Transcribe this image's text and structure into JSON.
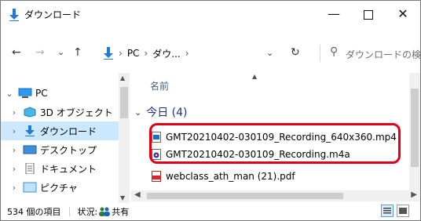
{
  "window": {
    "title": "ダウンロード"
  },
  "controls": {
    "minimize": "—",
    "maximize": "",
    "close": "✕"
  },
  "nav": {
    "back": "←",
    "forward": "→",
    "recent": "⌄",
    "up": "↑"
  },
  "address": {
    "part1": "PC",
    "part2": "ダウ...",
    "sep": "›",
    "dropdown": "⌄",
    "refresh": "↻"
  },
  "search": {
    "placeholder": "ダウンロードの検"
  },
  "tree": [
    {
      "label": "PC",
      "icon": "pc-icon",
      "chevron": "⌄"
    },
    {
      "label": "3D オブジェクト",
      "icon": "cube-icon",
      "chevron": "›"
    },
    {
      "label": "ダウンロード",
      "icon": "download-icon",
      "chevron": "›",
      "selected": true
    },
    {
      "label": "デスクトップ",
      "icon": "desktop-icon",
      "chevron": "›"
    },
    {
      "label": "ドキュメント",
      "icon": "document-icon",
      "chevron": "›"
    },
    {
      "label": "ピクチャ",
      "icon": "picture-icon",
      "chevron": "›"
    }
  ],
  "content": {
    "column_name": "名前",
    "group_label": "今日 (4)",
    "files": [
      {
        "name": "GMT20210402-030109_Recording_640x360.mp4",
        "icon": "video-file-icon"
      },
      {
        "name": "GMT20210402-030109_Recording.m4a",
        "icon": "audio-file-icon"
      },
      {
        "name": "webclass_ath_man (21).pdf",
        "icon": "pdf-file-icon"
      }
    ]
  },
  "status": {
    "count": "534 個の項目",
    "share_label": "状況:",
    "share_value": "共有"
  },
  "colors": {
    "accent": "#0063b1",
    "selected_bg": "#cce8ff",
    "highlight": "#e0001a",
    "group": "#1e3287"
  }
}
